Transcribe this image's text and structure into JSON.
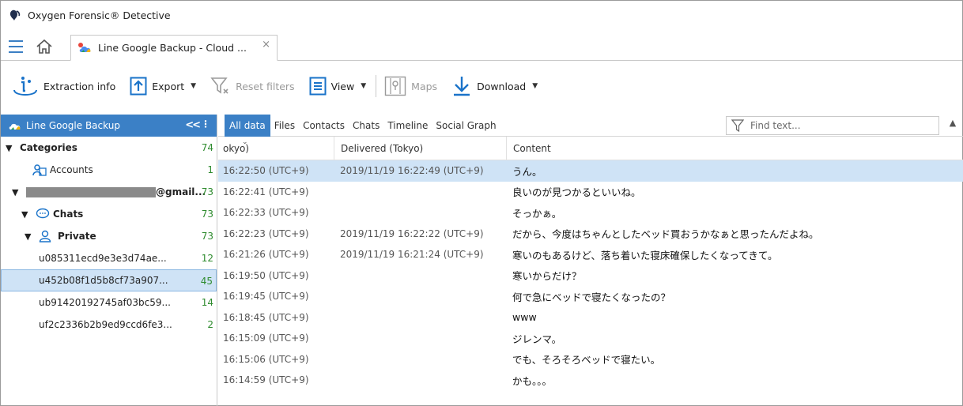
{
  "app": {
    "title": "Oxygen Forensic® Detective"
  },
  "tab": {
    "label": "Line Google Backup - Cloud ...",
    "close": "×"
  },
  "toolbar": {
    "extraction": "Extraction info",
    "export": "Export",
    "reset": "Reset filters",
    "view": "View",
    "maps": "Maps",
    "download": "Download"
  },
  "sidebar": {
    "header": "Line Google Backup",
    "items": [
      {
        "label": "Categories",
        "count": "74"
      },
      {
        "label": "Accounts",
        "count": "1"
      },
      {
        "label": "@gmail...",
        "count": "73"
      },
      {
        "label": "Chats",
        "count": "73"
      },
      {
        "label": "Private",
        "count": "73"
      },
      {
        "label": "u085311ecd9e3e3d74ae...",
        "count": "12"
      },
      {
        "label": "u452b08f1d5b8cf73a907...",
        "count": "45"
      },
      {
        "label": "ub91420192745af03bc59...",
        "count": "14"
      },
      {
        "label": "uf2c2336b2b9ed9ccd6fe3...",
        "count": "2"
      }
    ]
  },
  "data_tabs": [
    "All data",
    "Files",
    "Contacts",
    "Chats",
    "Timeline",
    "Social Graph"
  ],
  "search": {
    "placeholder": "Find text..."
  },
  "grid": {
    "headers": [
      "okyo)",
      "Delivered (Tokyo)",
      "Content"
    ],
    "rows": [
      {
        "time": "16:22:50 (UTC+9)",
        "delivered": "2019/11/19 16:22:49 (UTC+9)",
        "content": "うん。"
      },
      {
        "time": "16:22:41 (UTC+9)",
        "delivered": "",
        "content": "良いのが見つかるといいね。"
      },
      {
        "time": "16:22:33 (UTC+9)",
        "delivered": "",
        "content": "そっかぁ。"
      },
      {
        "time": "16:22:23 (UTC+9)",
        "delivered": "2019/11/19 16:22:22 (UTC+9)",
        "content": "だから、今度はちゃんとしたベッド買おうかなぁと思ったんだよね。"
      },
      {
        "time": "16:21:26 (UTC+9)",
        "delivered": "2019/11/19 16:21:24 (UTC+9)",
        "content": "寒いのもあるけど、落ち着いた寝床確保したくなってきて。"
      },
      {
        "time": "16:19:50 (UTC+9)",
        "delivered": "",
        "content": "寒いからだけ？"
      },
      {
        "time": "16:19:45 (UTC+9)",
        "delivered": "",
        "content": "何で急にベッドで寝たくなったの？"
      },
      {
        "time": "16:18:45 (UTC+9)",
        "delivered": "",
        "content": "www"
      },
      {
        "time": "16:15:09 (UTC+9)",
        "delivered": "",
        "content": "ジレンマ。"
      },
      {
        "time": "16:15:06 (UTC+9)",
        "delivered": "",
        "content": "でも、そろそろベッドで寝たい。"
      },
      {
        "time": "16:14:59 (UTC+9)",
        "delivered": "",
        "content": "かも。。。"
      }
    ]
  },
  "colors": {
    "accent": "#3b80c6",
    "selection": "#cfe3f6",
    "count_green": "#2e8b2e"
  }
}
